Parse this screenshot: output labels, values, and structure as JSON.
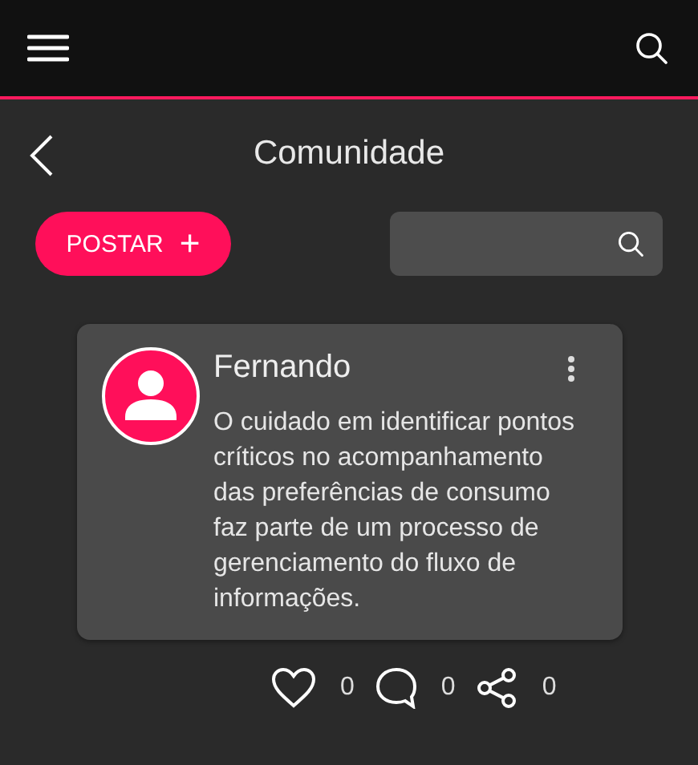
{
  "header": {
    "title": "Comunidade"
  },
  "post_button": {
    "label": "POSTAR",
    "icon": "+"
  },
  "posts": [
    {
      "author": "Fernando",
      "text": "O cuidado em identificar pontos críticos no acompanhamento das preferências de consumo faz parte de um processo de gerenciamento do fluxo de informações.",
      "actions": [
        {
          "kind": "like",
          "count": "0"
        },
        {
          "kind": "comment",
          "count": "0"
        },
        {
          "kind": "share",
          "count": "0"
        }
      ]
    }
  ]
}
